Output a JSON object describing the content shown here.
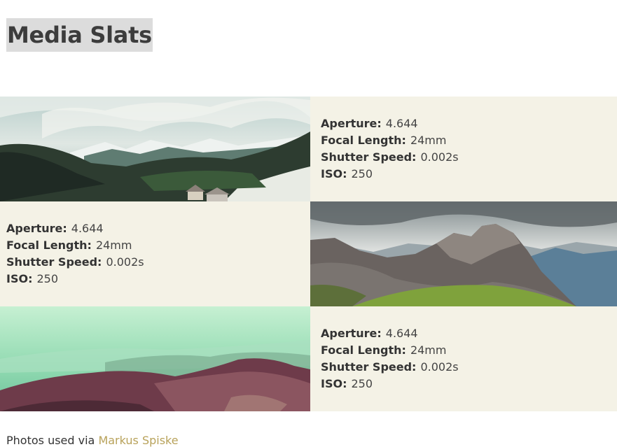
{
  "page": {
    "title": "Media Slats"
  },
  "slats": [
    {
      "image": "mountain valley with forest and cabin",
      "specs": [
        {
          "label": "Aperture:",
          "value": "4.644"
        },
        {
          "label": "Focal Length:",
          "value": "24mm"
        },
        {
          "label": "Shutter Speed:",
          "value": "0.002s"
        },
        {
          "label": "ISO:",
          "value": "250"
        }
      ]
    },
    {
      "image": "rocky mountain peaks under cloudy sky",
      "specs": [
        {
          "label": "Aperture:",
          "value": "4.644"
        },
        {
          "label": "Focal Length:",
          "value": "24mm"
        },
        {
          "label": "Shutter Speed:",
          "value": "0.002s"
        },
        {
          "label": "ISO:",
          "value": "250"
        }
      ]
    },
    {
      "image": "misty green-tinted mountain range",
      "specs": [
        {
          "label": "Aperture:",
          "value": "4.644"
        },
        {
          "label": "Focal Length:",
          "value": "24mm"
        },
        {
          "label": "Shutter Speed:",
          "value": "0.002s"
        },
        {
          "label": "ISO:",
          "value": "250"
        }
      ]
    }
  ],
  "credit": {
    "prefix": "Photos used via",
    "link": "Markus Spiske"
  },
  "colors": {
    "slat_bg": "#f4f2e6",
    "link": "#b8a25a",
    "title_highlight": "#dcdcdc"
  }
}
